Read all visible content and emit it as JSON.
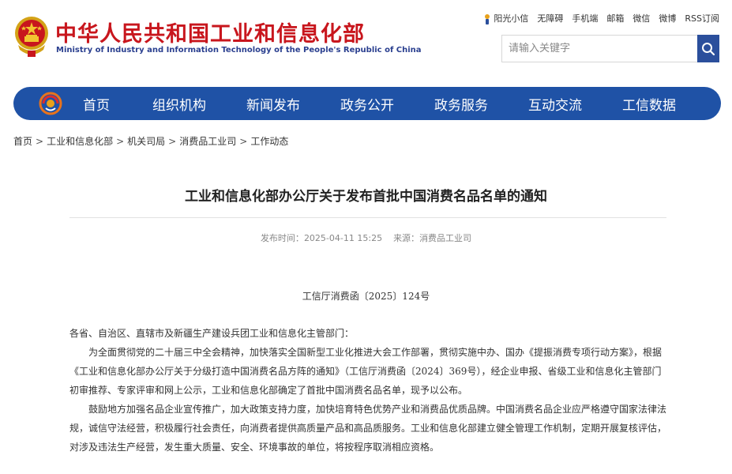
{
  "header": {
    "title": "中华人民共和国工业和信息化部",
    "subtitle": "Ministry of Industry and Information Technology of the People's Republic of China",
    "top_links": [
      "阳光小信",
      "无障碍",
      "手机端",
      "邮箱",
      "微信",
      "微博",
      "RSS订阅"
    ],
    "search_placeholder": "请输入关键字"
  },
  "nav": {
    "items": [
      "首页",
      "组织机构",
      "新闻发布",
      "政务公开",
      "政务服务",
      "互动交流",
      "工信数据"
    ]
  },
  "breadcrumb": [
    "首页",
    "工业和信息化部",
    "机关司局",
    "消费品工业司",
    "工作动态"
  ],
  "breadcrumb_separator": ">",
  "article": {
    "title": "工业和信息化部办公厅关于发布首批中国消费名品名单的通知",
    "publish_label": "发布时间：",
    "publish_time": "2025-04-11 15:25",
    "source_label": "来源：",
    "source": "消费品工业司",
    "doc_number": "工信厅消费函〔2025〕124号",
    "paragraphs": [
      "各省、自治区、直辖市及新疆生产建设兵团工业和信息化主管部门：",
      "为全面贯彻党的二十届三中全会精神，加快落实全国新型工业化推进大会工作部署，贯彻实施中办、国办《提振消费专项行动方案》，根据《工业和信息化部办公厅关于分级打造中国消费名品方阵的通知》（工信厅消费函〔2024〕369号），经企业申报、省级工业和信息化主管部门初审推荐、专家评审和网上公示，工业和信息化部确定了首批中国消费名品名单，现予以公布。",
      "鼓励地方加强名品企业宣传推广，加大政策支持力度，加快培育特色优势产业和消费品优质品牌。中国消费名品企业应严格遵守国家法律法规，诚信守法经营，积极履行社会责任，向消费者提供高质量产品和高品质服务。工业和信息化部建立健全管理工作机制，定期开展复核评估，对涉及违法生产经营，发生重大质量、安全、环境事故的单位，将按程序取消相应资格。"
    ]
  },
  "colors": {
    "brand_red": "#c8161d",
    "nav_blue": "#1f52a6",
    "search_button_blue": "#2b4f9c",
    "subtitle_blue": "#2a3f8f"
  },
  "icons": {
    "emblem": "national-emblem-icon",
    "sun": "sun-icon",
    "search": "search-icon",
    "nav_logo": "miit-logo-icon"
  }
}
